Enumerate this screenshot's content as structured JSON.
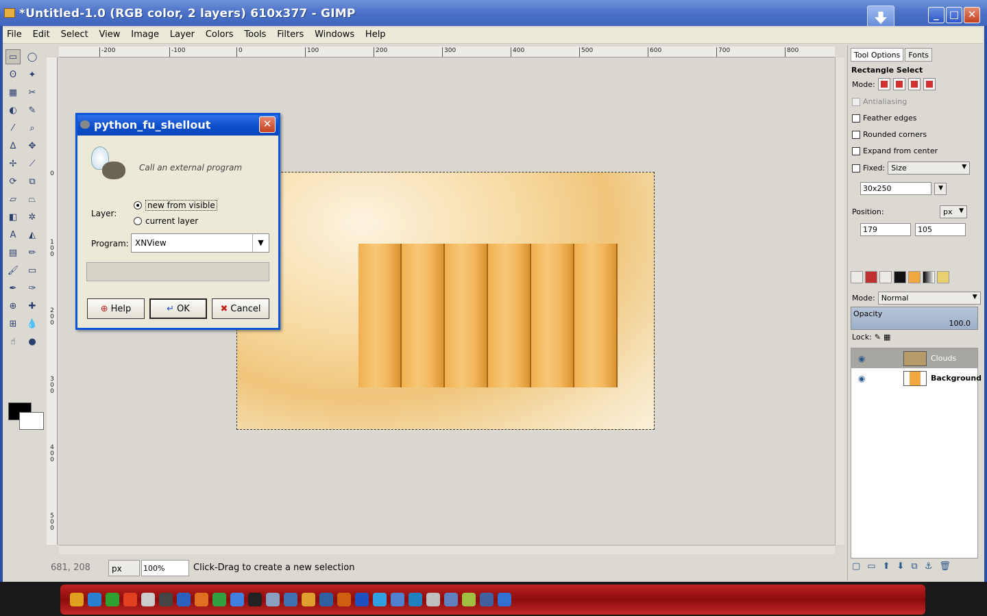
{
  "window": {
    "title": "*Untitled-1.0 (RGB color, 2 layers) 610x377 - GIMP",
    "minimize": "_",
    "maximize": "□",
    "close": "✕"
  },
  "menu": [
    "File",
    "Edit",
    "Select",
    "View",
    "Image",
    "Layer",
    "Colors",
    "Tools",
    "Filters",
    "Windows",
    "Help"
  ],
  "ruler_top": [
    "-200",
    "-100",
    "0",
    "100",
    "200",
    "300",
    "400",
    "500",
    "600",
    "700",
    "800"
  ],
  "ruler_left": [
    "0",
    "100",
    "200",
    "300",
    "400",
    "500"
  ],
  "status": {
    "coords": "681, 208",
    "unit": "px",
    "zoom": "100",
    "zoom_suffix": "%",
    "message": "Click-Drag to create a new selection"
  },
  "dialog": {
    "title": "python_fu_shellout",
    "close": "✕",
    "description": "Call an external program",
    "layer_label": "Layer:",
    "radio_options": [
      "new from visible",
      "current layer"
    ],
    "selected_radio": 0,
    "program_label": "Program:",
    "program_value": "XNView",
    "buttons": {
      "help": "Help",
      "ok": "OK",
      "cancel": "Cancel"
    }
  },
  "tool_options": {
    "tabs": [
      "Tool Options",
      "Fonts"
    ],
    "title": "Rectangle Select",
    "mode_label": "Mode:",
    "antialiasing": "Antialiasing",
    "feather": "Feather edges",
    "rounded": "Rounded corners",
    "expand": "Expand from center",
    "fixed_label": "Fixed:",
    "fixed_value": "Size",
    "size_value": "30x250",
    "position_label": "Position:",
    "position_unit": "px",
    "pos_x": "179",
    "pos_y": "105"
  },
  "layers": {
    "mode_label": "Mode:",
    "mode_value": "Normal",
    "opacity_label": "Opacity",
    "opacity_value": "100.0",
    "lock_label": "Lock:",
    "items": [
      {
        "name": "Clouds",
        "selected": true
      },
      {
        "name": "Background",
        "selected": false
      }
    ]
  }
}
